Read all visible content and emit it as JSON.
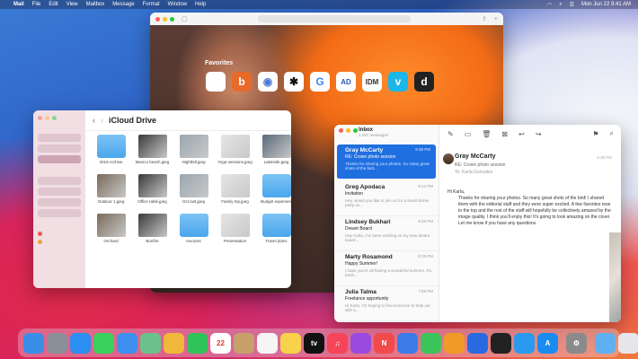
{
  "menubar": {
    "app": "Mail",
    "items": [
      "File",
      "Edit",
      "View",
      "Mailbox",
      "Message",
      "Format",
      "Window",
      "Help"
    ],
    "clock": "Mon Jun 22  9:41 AM"
  },
  "safari": {
    "favorites_title": "Favorites",
    "favorites": [
      {
        "icon": "apple-icon",
        "glyph": "",
        "label": "Apple",
        "color": "#555555",
        "bg": "#ffffff"
      },
      {
        "icon": "bing-icon",
        "glyph": "b",
        "label": "Bing",
        "color": "#ffffff",
        "bg": "#e86a2a"
      },
      {
        "icon": "compass-icon",
        "glyph": "◉",
        "label": "Safari",
        "color": "#4a7bd0",
        "bg": "#ffffff"
      },
      {
        "icon": "star-icon",
        "glyph": "✱",
        "label": "Yelp",
        "color": "#111111",
        "bg": "#ffffff"
      },
      {
        "icon": "google-icon",
        "glyph": "G",
        "label": "Google",
        "color": "#4285f4",
        "bg": "#ffffff"
      },
      {
        "icon": "ad-icon",
        "glyph": "AD",
        "label": "AD",
        "color": "#2a56b8",
        "bg": "#ffffff"
      },
      {
        "icon": "idm-icon",
        "glyph": "IDM",
        "label": "IDM",
        "color": "#333333",
        "bg": "#ffffff"
      },
      {
        "icon": "vimeo-icon",
        "glyph": "v",
        "label": "Vimeo",
        "color": "#ffffff",
        "bg": "#1ab7ea"
      },
      {
        "icon": "d-icon",
        "glyph": "d",
        "label": "Dictionary",
        "color": "#ffffff",
        "bg": "#222222"
      }
    ]
  },
  "finder": {
    "title": "iCloud Drive",
    "items": [
      {
        "kind": "folder",
        "name": "2019 Archive"
      },
      {
        "kind": "photo",
        "name": "Mexico beach.jpeg"
      },
      {
        "kind": "photo",
        "name": "Nightfall.jpeg"
      },
      {
        "kind": "photo",
        "name": "Yoga sessions.jpeg"
      },
      {
        "kind": "photo",
        "name": "Lakeside.jpeg"
      },
      {
        "kind": "photo",
        "name": "Outdoor 1.jpeg"
      },
      {
        "kind": "photo",
        "name": "Office table.jpeg"
      },
      {
        "kind": "photo",
        "name": "Oct last.jpeg"
      },
      {
        "kind": "photo",
        "name": "Family trip.jpeg"
      },
      {
        "kind": "folder",
        "name": "Budget expenses"
      },
      {
        "kind": "photo",
        "name": "Orchard"
      },
      {
        "kind": "photo",
        "name": "Bonfire"
      },
      {
        "kind": "folder",
        "name": "Invoices"
      },
      {
        "kind": "photo",
        "name": "Presentation"
      },
      {
        "kind": "folder",
        "name": "Travel plans"
      }
    ]
  },
  "mail": {
    "mailbox": "Inbox",
    "count": "1 287 messages",
    "messages": [
      {
        "from": "Gray McCarty",
        "time": "9:38 PM",
        "subject": "RE: Crown photo session",
        "preview": "Thanks for sharing your photos. So many great shots of the bird...",
        "selected": true
      },
      {
        "from": "Greg Apodaca",
        "time": "9:12 PM",
        "subject": "Invitation",
        "preview": "Hey, would you like to join us for a small dinner party on...",
        "selected": false
      },
      {
        "from": "Lindsey Bukhari",
        "time": "8:46 PM",
        "subject": "Dream Board",
        "preview": "Hey Karla, I've been working on my new dream board...",
        "selected": false
      },
      {
        "from": "Marty Rosamond",
        "time": "8:19 PM",
        "subject": "Happy Summer!",
        "preview": "I hope you're all having a wonderful summer. It's been...",
        "selected": false
      },
      {
        "from": "Julia Talma",
        "time": "7:59 PM",
        "subject": "Freelance opportunity",
        "preview": "Hi Karla, I'm hoping to find someone to help out with a...",
        "selected": false
      }
    ],
    "reader": {
      "from": "Gray McCarty",
      "subject": "RE: Crown photo session",
      "to": "To: Karla Gonzalez",
      "time": "9:38 PM",
      "greeting": "Hi Karla,",
      "body": "Thanks for sharing your photos. So many great shots of the bird! I shared them with the editorial staff and they were super excited. A few favorites rose to the top and the rest of the staff will hopefully be collectively amazed by the image quality. I think you'll enjoy this! It's going to look amazing on the cover. Let me know if you have any questions."
    }
  },
  "dock": [
    {
      "icon": "finder-icon",
      "bg": "#3b8ee8"
    },
    {
      "icon": "launchpad-icon",
      "bg": "#8a8f99"
    },
    {
      "icon": "safari-icon",
      "bg": "#2a8ff0"
    },
    {
      "icon": "messages-icon",
      "bg": "#3ad15b"
    },
    {
      "icon": "mail-icon",
      "bg": "#3d8fef"
    },
    {
      "icon": "maps-icon",
      "bg": "#6ac28a"
    },
    {
      "icon": "photos-icon",
      "bg": "#f0b73a"
    },
    {
      "icon": "facetime-icon",
      "bg": "#2fc35a"
    },
    {
      "icon": "calendar-icon",
      "bg": "#ffffff",
      "glyph": "22",
      "fg": "#e2362e"
    },
    {
      "icon": "contacts-icon",
      "bg": "#c8a06a"
    },
    {
      "icon": "reminders-icon",
      "bg": "#f5f5f5"
    },
    {
      "icon": "notes-icon",
      "bg": "#f7d24a"
    },
    {
      "icon": "tv-icon",
      "bg": "#111111",
      "glyph": "tv"
    },
    {
      "icon": "music-icon",
      "bg": "#f5455a",
      "glyph": "♫"
    },
    {
      "icon": "podcasts-icon",
      "bg": "#9a4ae0"
    },
    {
      "icon": "news-icon",
      "bg": "#f04a4a",
      "glyph": "N"
    },
    {
      "icon": "keynote-icon",
      "bg": "#3a7be8"
    },
    {
      "icon": "numbers-icon",
      "bg": "#3cc45a"
    },
    {
      "icon": "pages-icon",
      "bg": "#f09a2a"
    },
    {
      "icon": "xcode-icon",
      "bg": "#2a6ae0"
    },
    {
      "icon": "stocks-icon",
      "bg": "#222222"
    },
    {
      "icon": "remote-icon",
      "bg": "#2a9af0"
    },
    {
      "icon": "app-store-icon",
      "bg": "#1a8cf0",
      "glyph": "A"
    },
    {
      "icon": "settings-icon",
      "bg": "#8a8a8a",
      "glyph": "⚙"
    },
    {
      "icon": "downloads-icon",
      "bg": "#5fb0f0"
    },
    {
      "icon": "trash-icon",
      "bg": "#e6e6ea"
    }
  ]
}
